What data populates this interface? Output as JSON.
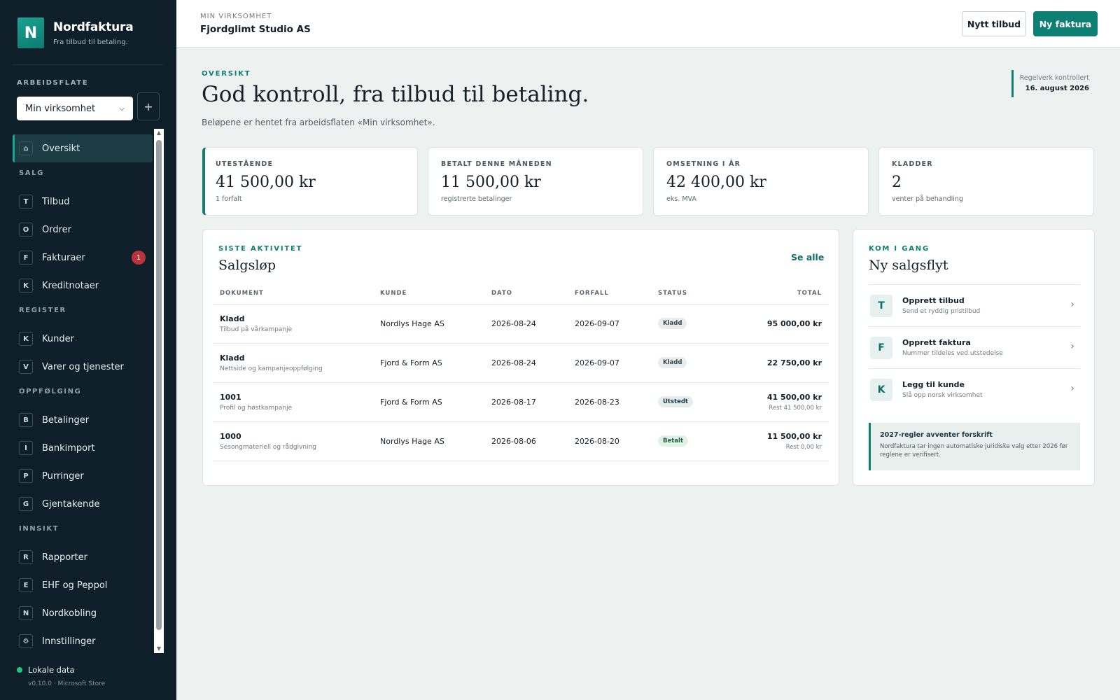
{
  "app": {
    "name": "Nordfaktura",
    "tagline": "Fra tilbud til betaling.",
    "logo_letter": "N"
  },
  "colors": {
    "accent": "#0d7f73",
    "sidebar_bg": "#0f1f2a",
    "badge": "#b9343a",
    "status_ok": "#22c77d"
  },
  "sidebar": {
    "workspace_label": "ARBEIDSFLATE",
    "workspace_value": "Min virksomhet",
    "add_label": "+",
    "items": [
      {
        "key": "⌂",
        "label": "Oversikt",
        "active": true
      },
      {
        "section": "SALG"
      },
      {
        "key": "T",
        "label": "Tilbud"
      },
      {
        "key": "O",
        "label": "Ordrer"
      },
      {
        "key": "F",
        "label": "Fakturaer",
        "badge": "1"
      },
      {
        "key": "K",
        "label": "Kreditnotaer"
      },
      {
        "section": "REGISTER"
      },
      {
        "key": "K",
        "label": "Kunder"
      },
      {
        "key": "V",
        "label": "Varer og tjenester"
      },
      {
        "section": "OPPFØLGING"
      },
      {
        "key": "B",
        "label": "Betalinger"
      },
      {
        "key": "I",
        "label": "Bankimport"
      },
      {
        "key": "P",
        "label": "Purringer"
      },
      {
        "key": "G",
        "label": "Gjentakende"
      },
      {
        "section": "INNSIKT"
      },
      {
        "key": "R",
        "label": "Rapporter"
      },
      {
        "key": "E",
        "label": "EHF og Peppol"
      },
      {
        "key": "N",
        "label": "Nordkobling"
      },
      {
        "key": "⚙",
        "label": "Innstillinger"
      }
    ],
    "footer_status": "Lokale data",
    "version": "v0.10.0 · Microsoft Store"
  },
  "topbar": {
    "label": "MIN VIRKSOMHET",
    "company": "Fjordglimt Studio AS",
    "btn_offer": "Nytt tilbud",
    "btn_invoice": "Ny faktura"
  },
  "hero": {
    "eyebrow": "OVERSIKT",
    "title": "God kontroll, fra tilbud til betaling.",
    "subtitle": "Beløpene er hentet fra arbeidsflaten «Min virksomhet».",
    "rule_label": "Regelverk kontrollert",
    "rule_date": "16. august 2026"
  },
  "stats": [
    {
      "label": "UTESTÅENDE",
      "value": "41 500,00 kr",
      "note": "1 forfalt"
    },
    {
      "label": "BETALT DENNE MÅNEDEN",
      "value": "11 500,00 kr",
      "note": "registrerte betalinger"
    },
    {
      "label": "OMSETNING I ÅR",
      "value": "42 400,00 kr",
      "note": "eks. MVA"
    },
    {
      "label": "KLADDER",
      "value": "2",
      "note": "venter på behandling"
    }
  ],
  "activity": {
    "eyebrow": "SISTE AKTIVITET",
    "title": "Salgsløp",
    "see_all": "Se alle",
    "columns": [
      "DOKUMENT",
      "KUNDE",
      "DATO",
      "FORFALL",
      "STATUS",
      "TOTAL"
    ],
    "rows": [
      {
        "doc": "Kladd",
        "desc": "Tilbud på vårkampanje",
        "customer": "Nordlys Hage AS",
        "date": "2026-08-24",
        "due": "2026-09-07",
        "status": "Kladd",
        "status_kind": "kladd",
        "total": "95 000,00 kr",
        "rest": ""
      },
      {
        "doc": "Kladd",
        "desc": "Nettside og kampanjeoppfølging",
        "customer": "Fjord & Form AS",
        "date": "2026-08-24",
        "due": "2026-09-07",
        "status": "Kladd",
        "status_kind": "kladd",
        "total": "22 750,00 kr",
        "rest": ""
      },
      {
        "doc": "1001",
        "desc": "Profil og høstkampanje",
        "customer": "Fjord & Form AS",
        "date": "2026-08-17",
        "due": "2026-08-23",
        "status": "Utstedt",
        "status_kind": "utstedt",
        "total": "41 500,00 kr",
        "rest": "Rest 41 500,00 kr"
      },
      {
        "doc": "1000",
        "desc": "Sesongmateriell og rådgivning",
        "customer": "Nordlys Hage AS",
        "date": "2026-08-06",
        "due": "2026-08-20",
        "status": "Betalt",
        "status_kind": "betalt",
        "total": "11 500,00 kr",
        "rest": "Rest 0,00 kr"
      }
    ]
  },
  "getting_started": {
    "eyebrow": "KOM I GANG",
    "title": "Ny salgsflyt",
    "actions": [
      {
        "key": "T",
        "title": "Opprett tilbud",
        "sub": "Send et ryddig pristilbud"
      },
      {
        "key": "F",
        "title": "Opprett faktura",
        "sub": "Nummer tildeles ved utstedelse"
      },
      {
        "key": "K",
        "title": "Legg til kunde",
        "sub": "Slå opp norsk virksomhet"
      }
    ],
    "notice_title": "2027-regler avventer forskrift",
    "notice_text": "Nordfaktura tar ingen automatiske juridiske valg etter 2026 før reglene er verifisert."
  }
}
